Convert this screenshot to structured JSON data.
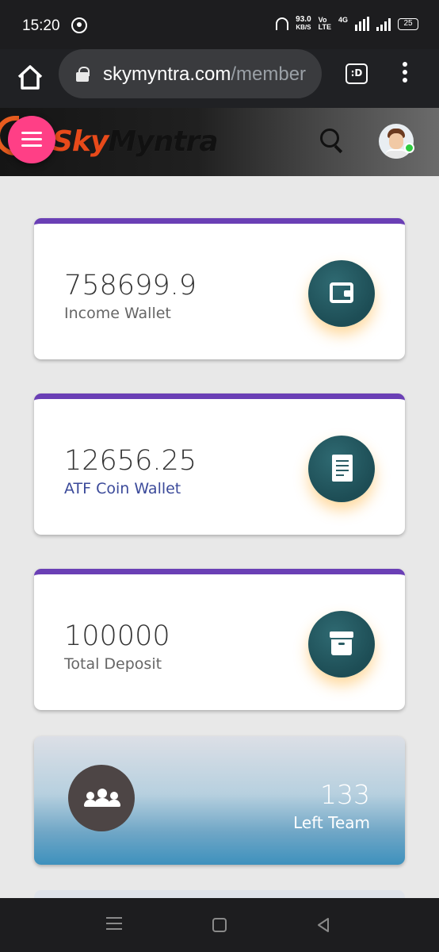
{
  "status_bar": {
    "time": "15:20",
    "net_speed_value": "93.0",
    "net_speed_unit": "KB/S",
    "volte_top": "Vo",
    "volte_bottom": "LTE",
    "network": "4G",
    "battery": "25"
  },
  "browser": {
    "url_host": "skymyntra.com",
    "url_path": "/member",
    "tabs_label": ":D"
  },
  "header": {
    "logo_part1": "Sky",
    "logo_part2": "Myntra"
  },
  "cards": [
    {
      "value": "758699.9",
      "label": "Income Wallet",
      "icon": "wallet-icon"
    },
    {
      "value": "12656.25",
      "label": "ATF Coin Wallet",
      "icon": "receipt-icon"
    },
    {
      "value": "100000",
      "label": "Total Deposit",
      "icon": "archive-box-icon"
    }
  ],
  "team_card": {
    "value": "133",
    "label": "Left Team",
    "icon": "team-icon"
  },
  "colors": {
    "card_top_border": "#6a3fb5",
    "icon_circle": "#1d4d55",
    "hamburger": "#ff3f86",
    "atf_label": "#3b4a9a"
  }
}
